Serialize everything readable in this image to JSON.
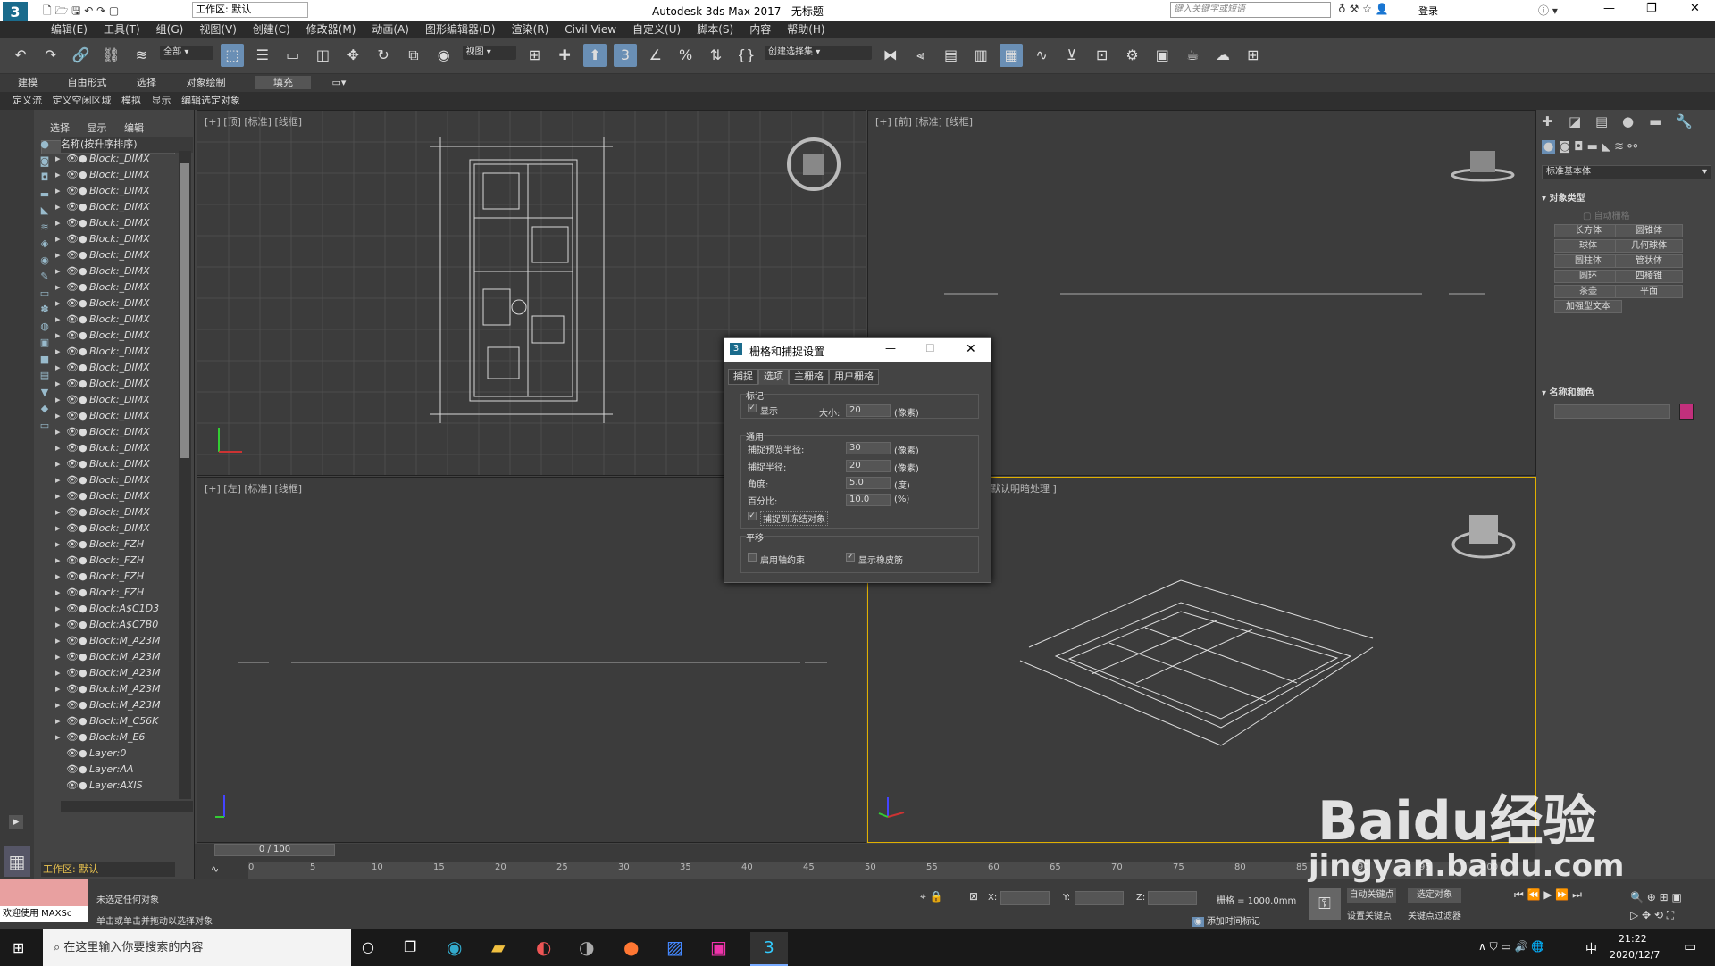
{
  "titlebar": {
    "app_title": "Autodesk 3ds Max 2017",
    "doc_title": "无标题",
    "workspace": "工作区: 默认",
    "search_placeholder": "键入关键字或短语",
    "login": "登录"
  },
  "menu": [
    "编辑(E)",
    "工具(T)",
    "组(G)",
    "视图(V)",
    "创建(C)",
    "修改器(M)",
    "动画(A)",
    "图形编辑器(D)",
    "渲染(R)",
    "Civil View",
    "自定义(U)",
    "脚本(S)",
    "内容",
    "帮助(H)"
  ],
  "toolbar": {
    "selection_filter": "全部",
    "ref_coord": "视图",
    "named_selection": "创建选择集"
  },
  "ribbon_tabs": [
    "建模",
    "自由形式",
    "选择",
    "对象绘制",
    "填充"
  ],
  "ribbon_sub": [
    "定义流",
    "定义空闲区域",
    "模拟",
    "显示",
    "编辑选定对象"
  ],
  "scene_explorer": {
    "tabs": [
      "选择",
      "显示",
      "编辑"
    ],
    "header": "名称(按升序排序)",
    "rows": [
      "Block:_DIMX",
      "Block:_DIMX",
      "Block:_DIMX",
      "Block:_DIMX",
      "Block:_DIMX",
      "Block:_DIMX",
      "Block:_DIMX",
      "Block:_DIMX",
      "Block:_DIMX",
      "Block:_DIMX",
      "Block:_DIMX",
      "Block:_DIMX",
      "Block:_DIMX",
      "Block:_DIMX",
      "Block:_DIMX",
      "Block:_DIMX",
      "Block:_DIMX",
      "Block:_DIMX",
      "Block:_DIMX",
      "Block:_DIMX",
      "Block:_DIMX",
      "Block:_DIMX",
      "Block:_DIMX",
      "Block:_DIMX",
      "Block:_FZH",
      "Block:_FZH",
      "Block:_FZH",
      "Block:_FZH",
      "Block:A$C1D3",
      "Block:A$C7B0",
      "Block:M_A23M",
      "Block:M_A23M",
      "Block:M_A23M",
      "Block:M_A23M",
      "Block:M_A23M",
      "Block:M_C56K",
      "Block:M_E6",
      "Layer:0",
      "Layer:AA",
      "Layer:AXIS"
    ],
    "workspace": "工作区: 默认"
  },
  "viewports": {
    "top": "[+] [顶] [标准] [线框]",
    "front": "[+] [前] [标准] [线框]",
    "left": "[+] [左] [标准] [线框]",
    "persp": "默认明暗处理 ]"
  },
  "dialog": {
    "title": "栅格和捕捉设置",
    "tabs": [
      "捕捉",
      "选项",
      "主栅格",
      "用户栅格"
    ],
    "active_tab": "选项",
    "marker": {
      "label": "标记",
      "show": "显示",
      "size_label": "大小:",
      "size": "20",
      "size_unit": "(像素)"
    },
    "general": {
      "label": "通用",
      "preview_radius_label": "捕捉预览半径:",
      "preview_radius": "30",
      "preview_unit": "(像素)",
      "snap_radius_label": "捕捉半径:",
      "snap_radius": "20",
      "snap_unit": "(像素)",
      "angle_label": "角度:",
      "angle": "5.0",
      "angle_unit": "(度)",
      "percent_label": "百分比:",
      "percent": "10.0",
      "percent_unit": "(%)",
      "frozen": "捕捉到冻结对象"
    },
    "translate": {
      "label": "平移",
      "axis": "启用轴约束",
      "rubber": "显示橡皮筋"
    }
  },
  "command_panel": {
    "dropdown": "标准基本体",
    "object_type": "对象类型",
    "autogrid": "自动栅格",
    "buttons": [
      "长方体",
      "圆锥体",
      "球体",
      "几何球体",
      "圆柱体",
      "管状体",
      "圆环",
      "四棱锥",
      "茶壶",
      "平面",
      "加强型文本"
    ],
    "name_color": "名称和颜色",
    "object_color": "#c2307c"
  },
  "timeline": {
    "frame": "0 / 100",
    "ticks": [
      "0",
      "5",
      "10",
      "15",
      "20",
      "25",
      "30",
      "35",
      "40",
      "45",
      "50",
      "55",
      "60",
      "65",
      "70",
      "75",
      "80",
      "85",
      "90",
      "95",
      "100"
    ]
  },
  "status": {
    "maxscript": "欢迎使用 MAXSc",
    "line1": "未选定任何对象",
    "line2": "单击或单击并拖动以选择对象",
    "x_label": "X:",
    "y_label": "Y:",
    "z_label": "Z:",
    "grid": "栅格 = 1000.0mm",
    "autokey": "自动关键点",
    "selected": "选定对象",
    "add_time_tag": "添加时间标记",
    "setkey": "设置关键点",
    "keyfilter": "关键点过滤器"
  },
  "taskbar": {
    "search": "在这里输入你要搜索的内容",
    "time": "21:22",
    "date": "2020/12/7",
    "ime": "中"
  },
  "watermark": {
    "brand": "Baidu经验",
    "url": "jingyan.baidu.com"
  }
}
